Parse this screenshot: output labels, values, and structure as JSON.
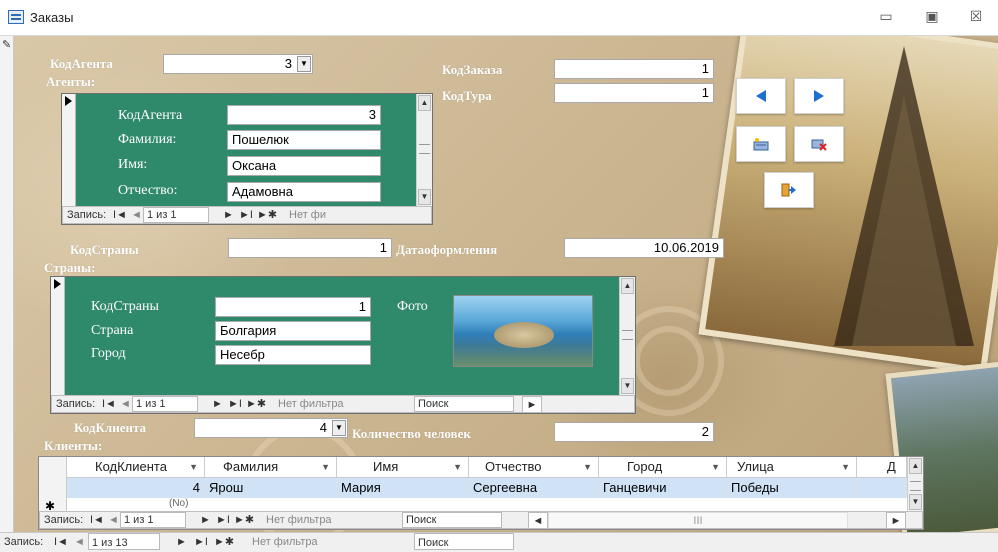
{
  "window": {
    "title": "Заказы",
    "minimize": "▭",
    "restore": "▣",
    "close": "☒"
  },
  "colors": {
    "form_bg": "#cdb894",
    "subform_bg": "#2e8a6a",
    "selected_row": "#cfe2f6",
    "nav_button_blue": "#1f6fd1"
  },
  "icons": {
    "record_selector": "pencil-icon",
    "prev": "triangle-left-icon",
    "next": "triangle-right-icon",
    "new": "new-record-icon",
    "delete": "delete-record-icon",
    "exit": "exit-door-icon"
  },
  "main": {
    "agent_code_label": "КодАгента",
    "agent_code_value": "3",
    "agents_label": "Агенты:",
    "order_code_label": "КодЗаказа",
    "order_code_value": "1",
    "tour_code_label": "КодТура",
    "tour_code_value": "1",
    "country_code_label": "КодСтраны",
    "country_code_value": "1",
    "date_label": "Датаоформления",
    "date_value": "10.06.2019",
    "countries_label": "Страны:",
    "client_code_label": "КодКлиента",
    "client_code_value": "4",
    "people_label": "Количество человек",
    "people_value": "2",
    "clients_label": "Клиенты:"
  },
  "agents_subform": {
    "code_label": "КодАгента",
    "code_value": "3",
    "surname_label": "Фамилия:",
    "surname_value": "Пошелюк",
    "name_label": "Имя:",
    "name_value": "Оксана",
    "patronymic_label": "Отчество:",
    "patronymic_value": "Адамовна",
    "nav": {
      "record_label": "Запись:",
      "first": "I◄",
      "prev": "◄",
      "current": "1 из 1",
      "next": "►",
      "last": "►I",
      "new": "►✱",
      "filter": "Нет фи"
    }
  },
  "countries_subform": {
    "code_label": "КодСтраны",
    "code_value": "1",
    "country_label": "Страна",
    "country_value": "Болгария",
    "city_label": "Город",
    "city_value": "Несебр",
    "photo_label": "Фото",
    "nav": {
      "record_label": "Запись:",
      "first": "I◄",
      "prev": "◄",
      "current": "1 из 1",
      "next": "►",
      "last": "►I",
      "new": "►✱",
      "filter": "Нет фильтра",
      "search": "Поиск"
    }
  },
  "clients_grid": {
    "columns": [
      "КодКлиента",
      "Фамилия",
      "Имя",
      "Отчество",
      "Город",
      "Улица",
      "Д"
    ],
    "row": [
      "4",
      "Ярош",
      "Мария",
      "Сергеевна",
      "Ганцевичи",
      "Победы",
      ""
    ],
    "new_row_marker": "✱",
    "new_row_text": "(No)",
    "nav": {
      "record_label": "Запись:",
      "first": "I◄",
      "prev": "◄",
      "current": "1 из 1",
      "next": "►",
      "last": "►I",
      "new": "►✱",
      "filter": "Нет фильтра",
      "search": "Поиск",
      "hscroll_grip": "III"
    }
  },
  "statusbar": {
    "record_label": "Запись:",
    "first": "I◄",
    "prev": "◄",
    "current": "1 из 13",
    "next": "►",
    "last": "►I",
    "new": "►✱",
    "filter": "Нет фильтра",
    "search": "Поиск"
  }
}
